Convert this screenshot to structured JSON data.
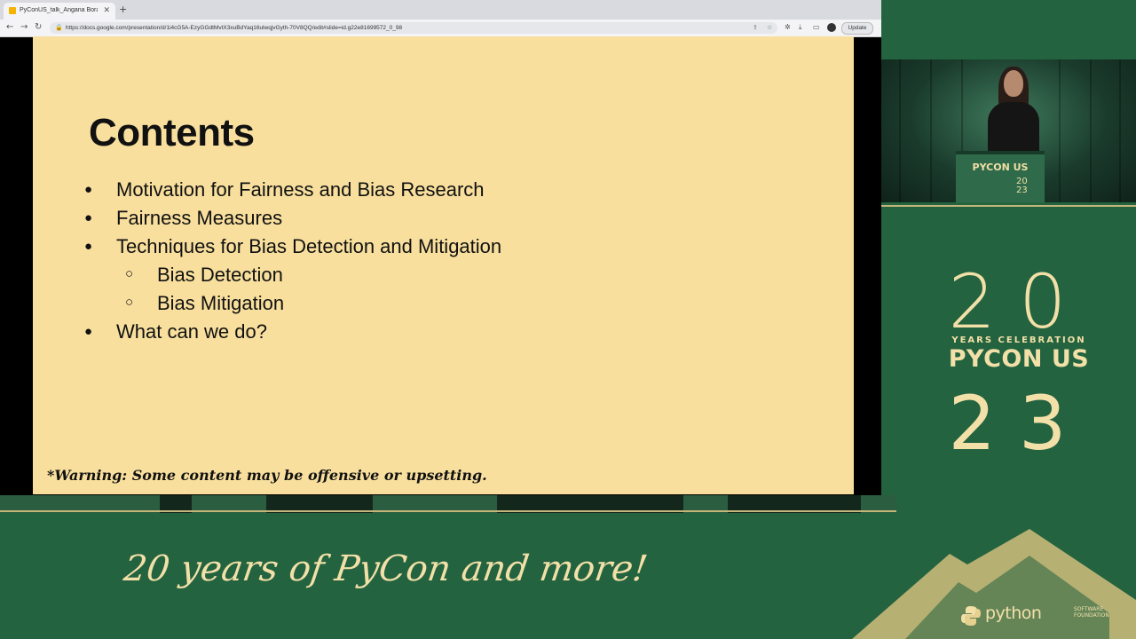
{
  "browser": {
    "tab_title": "PyConUS_talk_Angana Borah",
    "tab_close": "✕",
    "new_tab": "+",
    "back": "←",
    "forward": "→",
    "reload": "↻",
    "url": "https://docs.google.com/presentation/d/1i4cG5A-EzyGGdtMvtX3xuBdYaq16ulwqjvGyth-70V8QQ/edit#slide=id.g22e81699572_0_98",
    "update_label": "Update"
  },
  "slide": {
    "title": "Contents",
    "items": [
      {
        "level": 1,
        "text": "Motivation for Fairness and Bias Research"
      },
      {
        "level": 1,
        "text": "Fairness Measures"
      },
      {
        "level": 1,
        "text": "Techniques for Bias Detection and Mitigation"
      },
      {
        "level": 2,
        "text": "Bias Detection"
      },
      {
        "level": 2,
        "text": "Bias Mitigation"
      },
      {
        "level": 1,
        "text": "What can we do?"
      }
    ],
    "bullet_l1": "●",
    "bullet_l2": "○",
    "warning": "*Warning: Some content may be offensive or upsetting."
  },
  "speaker": {
    "podium_text": "PYCON US",
    "podium_year_top": "20",
    "podium_year_bottom": "23"
  },
  "branding": {
    "year_top": "20",
    "celebration": "YEARS CELEBRATION",
    "pycon": "PYCON US",
    "year_bottom": "23",
    "tagline": "20 years of PyCon and more!",
    "psf_name": "python",
    "psf_sub": "SOFTWARE FOUNDATION"
  },
  "colors": {
    "slide_bg": "#f8df9d",
    "brand_green": "#23633f",
    "brand_cream": "#f2e0a8"
  }
}
